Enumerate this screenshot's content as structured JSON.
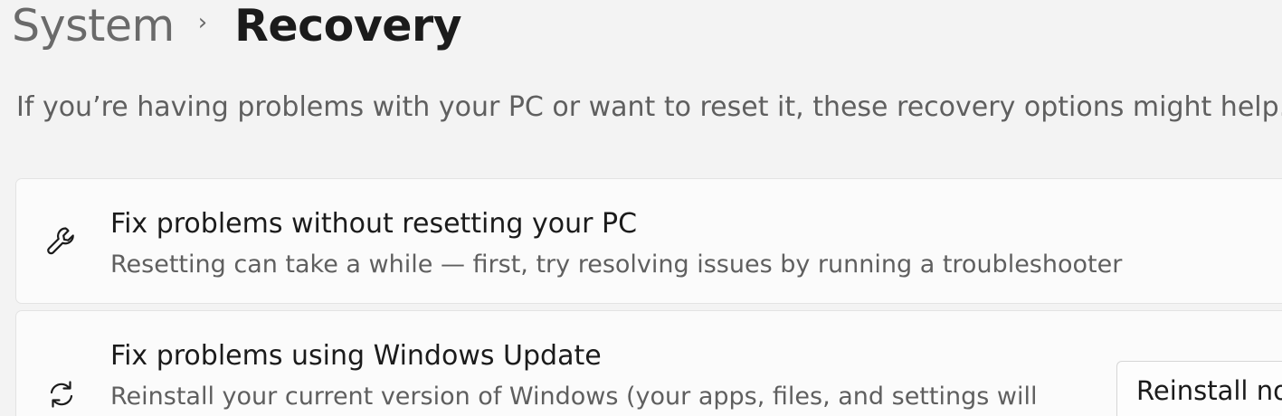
{
  "breadcrumb": {
    "parent": "System",
    "separator": "›",
    "current": "Recovery"
  },
  "description": "If you’re having problems with your PC or want to reset it, these recovery options might help.",
  "cards": [
    {
      "icon": "wrench-icon",
      "title": "Fix problems without resetting your PC",
      "subtitle": "Resetting can take a while — first, try resolving issues by running a troubleshooter"
    },
    {
      "icon": "refresh-icon",
      "title": "Fix problems using Windows Update",
      "subtitle": "Reinstall your current version of Windows (your apps, files, and settings will",
      "button_label": "Reinstall no"
    }
  ],
  "colors": {
    "background": "#f3f3f3",
    "card": "#fbfbfb",
    "text_primary": "#1b1b1b",
    "text_secondary": "#5f5f5f"
  }
}
